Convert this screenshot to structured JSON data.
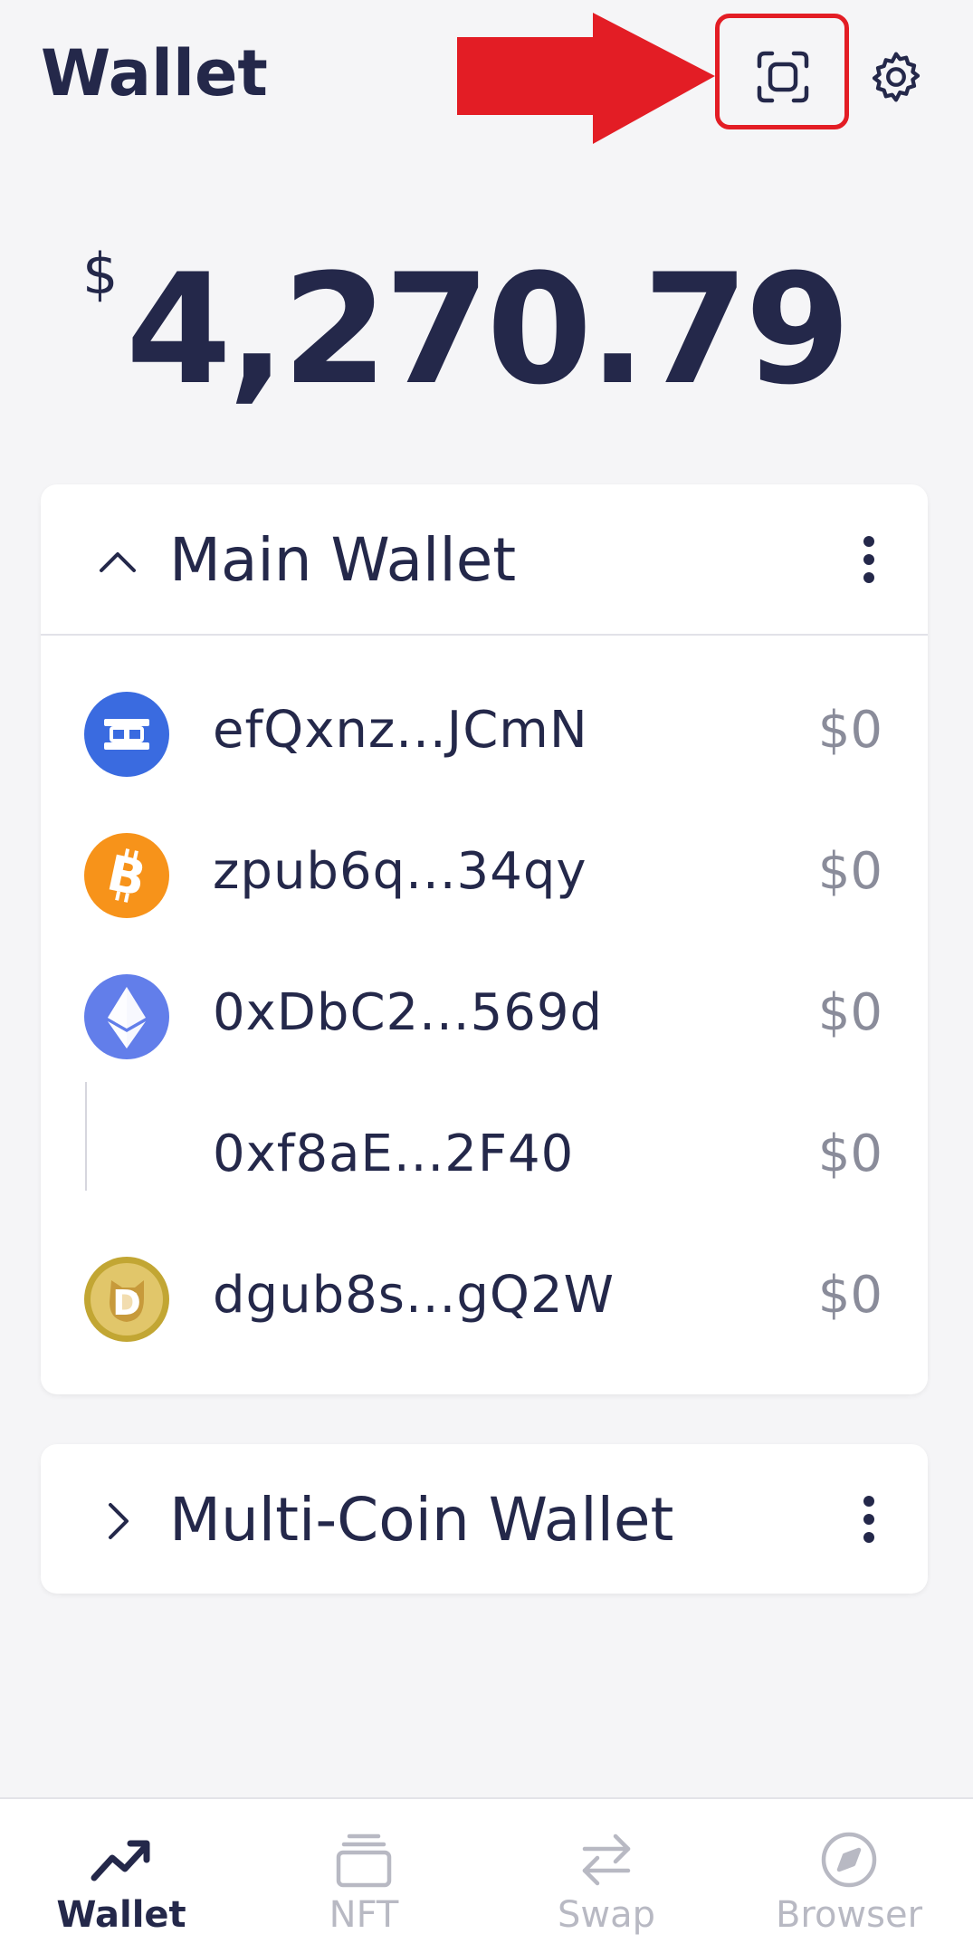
{
  "header": {
    "title": "Wallet",
    "scan_icon": "scan-icon",
    "settings_icon": "gear-icon"
  },
  "balance": {
    "currency": "$",
    "amount": "4,270.79"
  },
  "main_wallet": {
    "title": "Main Wallet",
    "expanded": true,
    "accounts": [
      {
        "coin": "etc-icon",
        "address": "efQxnz...JCmN",
        "value": "$0"
      },
      {
        "coin": "bitcoin-icon",
        "address": "zpub6q...34qy",
        "value": "$0"
      },
      {
        "coin": "ethereum-icon",
        "address": "0xDbC2...569d",
        "value": "$0"
      },
      {
        "coin": "",
        "address": "0xf8aE...2F40",
        "value": "$0"
      },
      {
        "coin": "dogecoin-icon",
        "address": "dgub8s...gQ2W",
        "value": "$0"
      }
    ]
  },
  "multi_coin_wallet": {
    "title": "Multi-Coin Wallet",
    "expanded": false
  },
  "nav": {
    "items": [
      {
        "label": "Wallet",
        "icon": "chart-trend-icon",
        "active": true
      },
      {
        "label": "NFT",
        "icon": "stack-icon",
        "active": false
      },
      {
        "label": "Swap",
        "icon": "swap-arrows-icon",
        "active": false
      },
      {
        "label": "Browser",
        "icon": "compass-icon",
        "active": false
      }
    ]
  },
  "colors": {
    "text_primary": "#24284a",
    "text_muted": "#8a8c9a",
    "nav_inactive": "#b8b9c3",
    "annotation_red": "#e31d25",
    "background": "#f5f5f7",
    "etc_blue": "#3a6be0",
    "btc_orange": "#f7931a",
    "eth_blue": "#627eea",
    "doge_gold": "#c2a633"
  }
}
